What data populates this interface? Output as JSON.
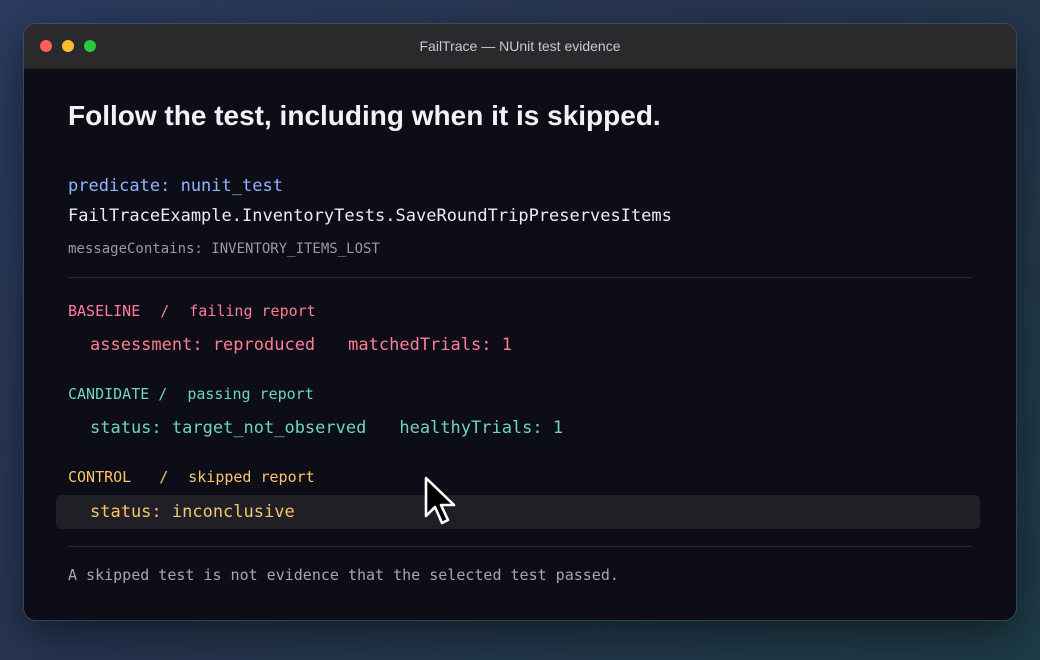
{
  "window": {
    "title": "FailTrace — NUnit test evidence"
  },
  "header": {
    "heading": "Follow the test, including when it is skipped.",
    "predicate": "predicate: nunit_test",
    "test_name": "FailTraceExample.InventoryTests.SaveRoundTripPreservesItems",
    "message_contains": "messageContains: INVENTORY_ITEMS_LOST"
  },
  "sections": {
    "baseline": {
      "label": "BASELINE",
      "separator": "/",
      "report": "failing report",
      "field1": "assessment: reproduced",
      "field2": "matchedTrials: 1"
    },
    "candidate": {
      "label": "CANDIDATE",
      "separator": "/",
      "report": "passing report",
      "field1": "status: target_not_observed",
      "field2": "healthyTrials: 1"
    },
    "control": {
      "label": "CONTROL",
      "separator": "/",
      "report": "skipped report",
      "field1": "status: inconclusive"
    }
  },
  "footer": {
    "note": "A skipped test is not evidence that the selected test passed."
  },
  "colors": {
    "baseline": "#ff7e93",
    "candidate": "#6fd3c0",
    "control": "#f8c46c",
    "predicate": "#8fb4ff"
  },
  "icons": {
    "cursor": "mouse-pointer-icon"
  }
}
